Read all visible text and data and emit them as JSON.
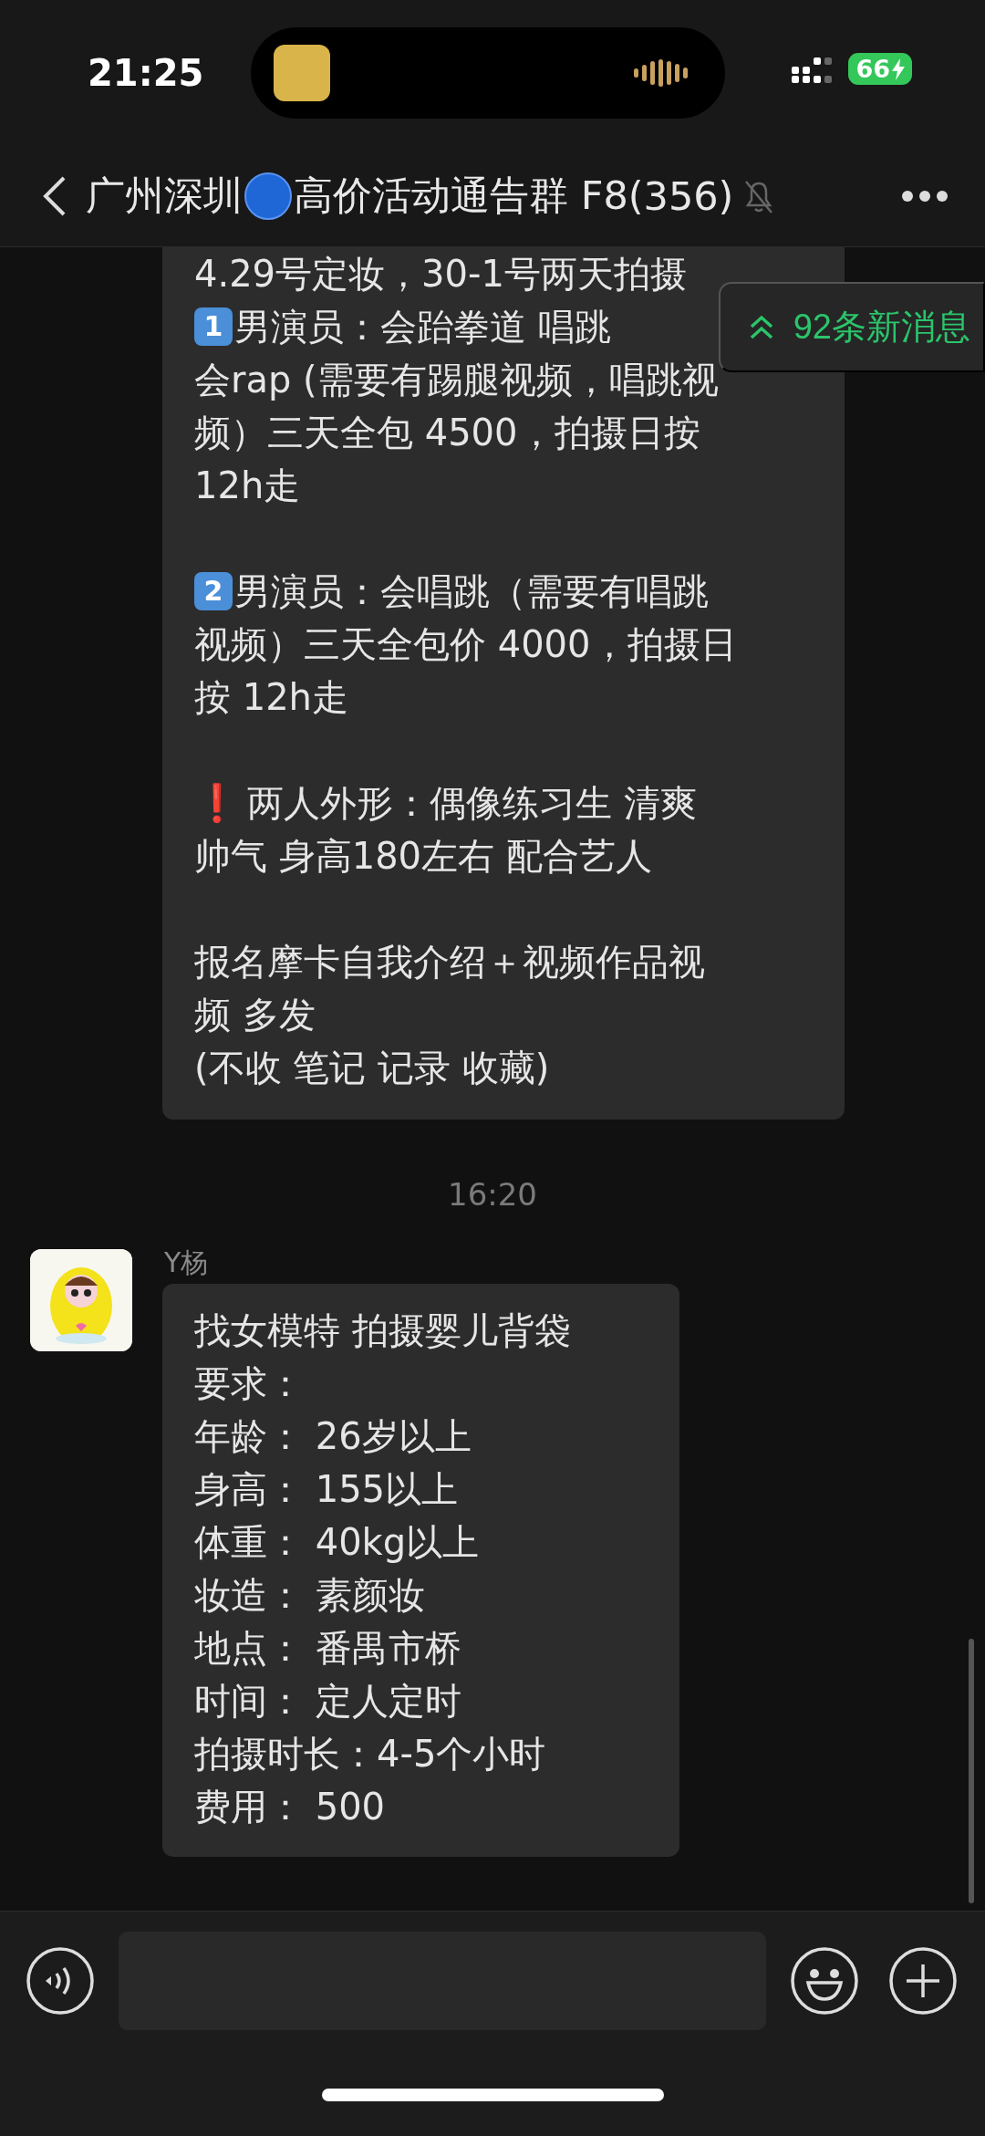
{
  "status_bar": {
    "time": "21:25",
    "battery": "66"
  },
  "header": {
    "title_before": "广州深圳",
    "title_after": "高价活动通告群 F8",
    "member_count": "(356)",
    "muted": true
  },
  "new_messages_badge": "92条新消息",
  "messages": [
    {
      "kind": "bubble",
      "paragraphs": [
        [
          {
            "text": "4.29号定妆，30-1号两天拍摄"
          },
          {
            "keycap": "1",
            "text": "男演员：会跆拳道 唱跳"
          },
          {
            "text": "会rap (需要有踢腿视频，唱跳视"
          },
          {
            "text": "频）三天全包 4500，拍摄日按"
          },
          {
            "text": "12h走"
          }
        ],
        [
          {
            "keycap": "2",
            "text": "男演员：会唱跳（需要有唱跳"
          },
          {
            "text": "视频）三天全包价 4000，拍摄日"
          },
          {
            "text": "按 12h走"
          }
        ],
        [
          {
            "prefix": "❗",
            "text": "两人外形：偶像练习生 清爽"
          },
          {
            "text": "帅气 身高180左右 配合艺人"
          }
        ],
        [
          {
            "text": "报名摩卡自我介绍＋视频作品视"
          },
          {
            "text": "频 多发"
          },
          {
            "text": "(不收 笔记 记录 收藏)"
          }
        ]
      ]
    },
    {
      "kind": "time",
      "text": "16:20"
    },
    {
      "kind": "bubble",
      "sender": "Y杨",
      "paragraphs": [
        [
          {
            "text": "找女模特  拍摄婴儿背袋"
          },
          {
            "text": "要求："
          },
          {
            "text": "年龄：  26岁以上"
          },
          {
            "text": "身高：  155以上"
          },
          {
            "text": "体重：  40kg以上"
          },
          {
            "text": "妆造：   素颜妆"
          },
          {
            "text": "地点：  番禺市桥"
          },
          {
            "text": "时间：  定人定时"
          },
          {
            "text": "拍摄时长：4-5个小时"
          },
          {
            "text": "费用：  500"
          }
        ]
      ]
    }
  ]
}
